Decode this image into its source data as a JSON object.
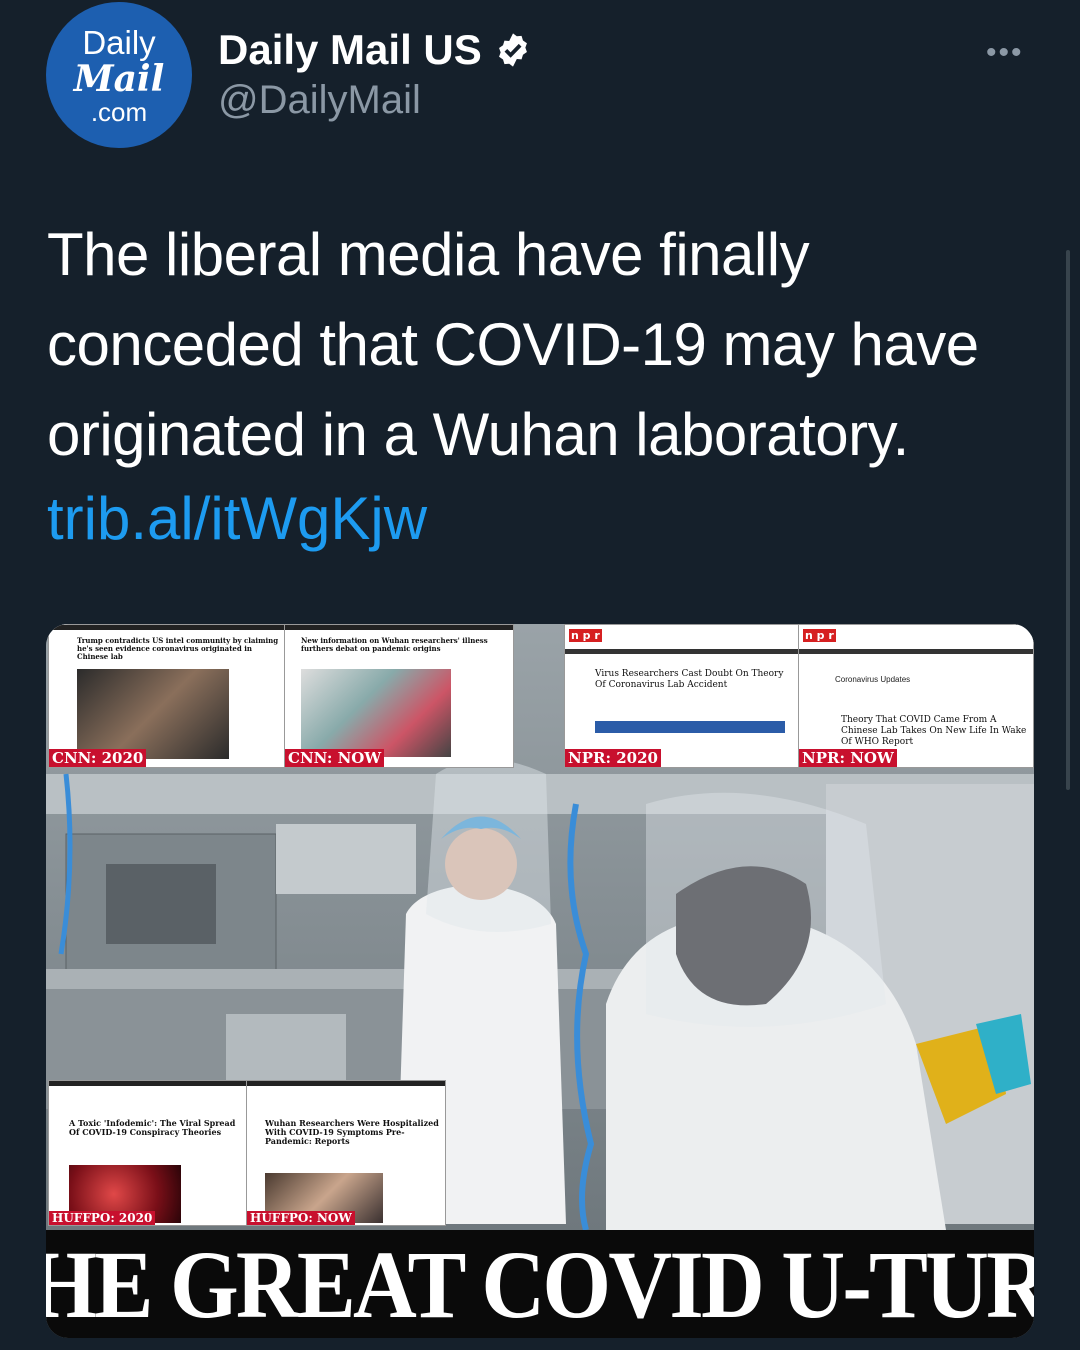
{
  "account": {
    "avatar_line1": "Daily",
    "avatar_line2": "Mail",
    "avatar_line3": ".com",
    "display_name": "Daily Mail US",
    "handle": "@DailyMail"
  },
  "tweet": {
    "text": "The liberal media have finally conceded that COVID-19 may have originated in a Wuhan laboratory.",
    "link": "trib.al/itWgKjw"
  },
  "media": {
    "banner": "THE GREAT COVID U-TURN",
    "screenshots": [
      {
        "tag": "CNN: 2020",
        "headline": "Trump contradicts US intel community by claiming he's seen evidence coronavirus originated in Chinese lab"
      },
      {
        "tag": "CNN: NOW",
        "headline": "New information on Wuhan researchers' illness furthers debat on pandemic origins"
      },
      {
        "tag": "NPR: 2020",
        "headline": "Virus Researchers Cast Doubt On Theory Of Coronavirus Lab Accident"
      },
      {
        "tag": "NPR: NOW",
        "sub": "Coronavirus Updates",
        "headline": "Theory That COVID Came From A Chinese Lab Takes On New Life In Wake Of WHO Report"
      },
      {
        "tag": "HUFFPO: 2020",
        "headline": "A Toxic 'Infodemic': The Viral Spread Of COVID-19 Conspiracy Theories"
      },
      {
        "tag": "HUFFPO: NOW",
        "headline": "Wuhan Researchers Were Hospitalized With COVID-19 Symptoms Pre-Pandemic: Reports"
      }
    ]
  },
  "colors": {
    "background": "#15202b",
    "link": "#1d9bf0",
    "muted": "#8b98a5",
    "avatar": "#1d5fb0"
  }
}
